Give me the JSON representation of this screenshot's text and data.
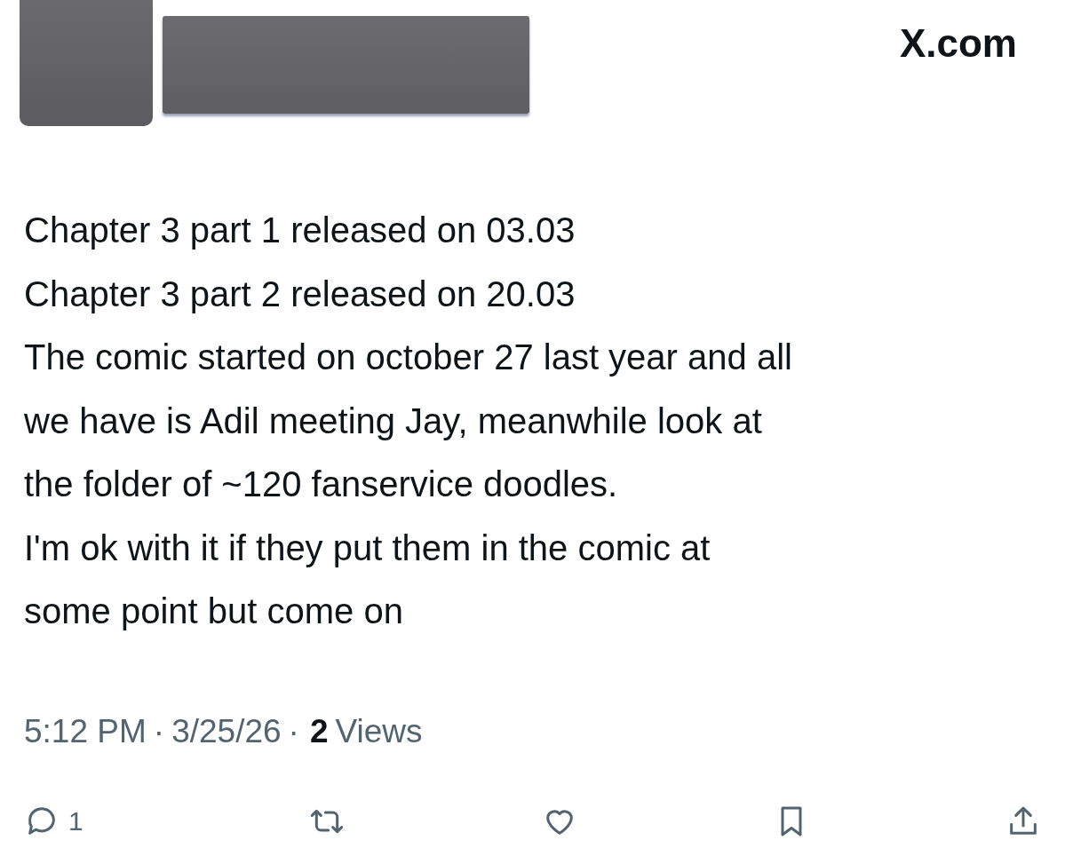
{
  "site": "X.com",
  "post": {
    "lines": [
      "Chapter 3 part 1 released on 03.03",
      "Chapter 3 part 2 released on 20.03",
      "The comic started on october 27 last year and all",
      "we have is Adil meeting Jay, meanwhile look at",
      "the folder of ~120 fanservice doodles.",
      "I'm ok with it if they put them in the comic at",
      "some point but come on"
    ],
    "time": "5:12 PM",
    "separator_1": "·",
    "date": "3/25/26",
    "separator_2": "·",
    "views_count": "2",
    "views_label": "Views"
  },
  "actions": {
    "reply_count": "1"
  }
}
